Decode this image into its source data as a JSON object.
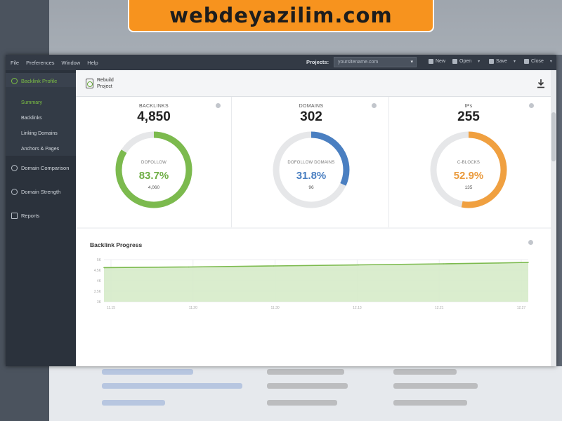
{
  "banner": {
    "text": "webdeyazilim.com"
  },
  "menubar": {
    "menus": [
      "File",
      "Preferences",
      "Window",
      "Help"
    ],
    "projects_label": "Projects:",
    "project_value": "yoursitename.com",
    "tools": [
      {
        "label": "New",
        "icon": "new-icon"
      },
      {
        "label": "Open",
        "icon": "folder-icon"
      },
      {
        "label": "Save",
        "icon": "save-icon"
      },
      {
        "label": "Close",
        "icon": "close-icon"
      }
    ]
  },
  "sidebar": {
    "items": [
      {
        "label": "Backlink Profile",
        "icon": "link-icon",
        "active": true
      },
      {
        "label": "Domain Comparison",
        "icon": "compare-icon"
      },
      {
        "label": "Domain Strength",
        "icon": "gauge-icon"
      },
      {
        "label": "Reports",
        "icon": "report-icon"
      }
    ],
    "subitems": [
      {
        "label": "Summary",
        "selected": true
      },
      {
        "label": "Backlinks"
      },
      {
        "label": "Linking Domains"
      },
      {
        "label": "Anchors & Pages"
      }
    ]
  },
  "toolbar": {
    "rebuild_line1": "Rebuild",
    "rebuild_line2": "Project"
  },
  "cards": [
    {
      "title": "BACKLINKS",
      "value": "4,850",
      "donut_label": "DOFOLLOW",
      "percent_text": "83.7%",
      "percent": 83.7,
      "count": "4,060",
      "color": "#7cba4e"
    },
    {
      "title": "DOMAINS",
      "value": "302",
      "donut_label": "DOFOLLOW DOMAINS",
      "percent_text": "31.8%",
      "percent": 31.8,
      "count": "96",
      "color": "#4a7fc1"
    },
    {
      "title": "IPs",
      "value": "255",
      "donut_label": "C-BLOCKS",
      "percent_text": "52.9%",
      "percent": 52.9,
      "count": "135",
      "color": "#f0a040"
    }
  ],
  "colors": {
    "accent_green": "#7dc144",
    "track": "#e6e7e9"
  },
  "chart_data": {
    "type": "area",
    "title": "Backlink Progress",
    "y_tick_labels": [
      "5K",
      "4.5K",
      "4K",
      "3.5K",
      "3K"
    ],
    "x_tick_labels": [
      "11.15",
      "11.20",
      "11.30",
      "12.13",
      "12.21",
      "12.27"
    ],
    "x": [
      0,
      0.2,
      0.4,
      0.6,
      0.8,
      0.93,
      1
    ],
    "values": [
      4620,
      4650,
      4700,
      4750,
      4800,
      4840,
      4870
    ],
    "ylim": [
      3000,
      5000
    ],
    "color": "#7cba4e",
    "fill": "#d6ebc9"
  }
}
